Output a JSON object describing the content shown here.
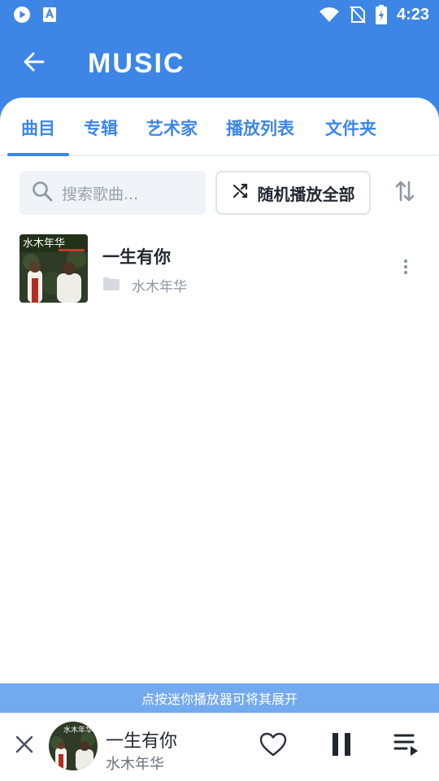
{
  "status_bar": {
    "time": "4:23",
    "icons": [
      "play-circle-icon",
      "text-a-icon",
      "wifi-icon",
      "no-sim-icon",
      "battery-charging-icon"
    ]
  },
  "app_bar": {
    "title": "MUSIC",
    "back_icon": "arrow-left-icon"
  },
  "tabs": [
    {
      "label": "曲目",
      "selected": true
    },
    {
      "label": "专辑",
      "selected": false
    },
    {
      "label": "艺术家",
      "selected": false
    },
    {
      "label": "播放列表",
      "selected": false
    },
    {
      "label": "文件夹",
      "selected": false
    }
  ],
  "search": {
    "placeholder": "搜索歌曲..."
  },
  "shuffle": {
    "label": "随机播放全部"
  },
  "songs": [
    {
      "title": "一生有你",
      "artist": "水木年华",
      "cover_text": "水木年华"
    }
  ],
  "hint": "点按迷你播放器可将其展开",
  "mini_player": {
    "title": "一生有你",
    "artist": "水木年华",
    "cover_text": "水木年华",
    "playing": true,
    "favorite": false
  },
  "colors": {
    "accent": "#3d86e6",
    "hint_bar": "#73a9ef",
    "text_primary": "#222831",
    "text_secondary": "#8e97a3"
  }
}
